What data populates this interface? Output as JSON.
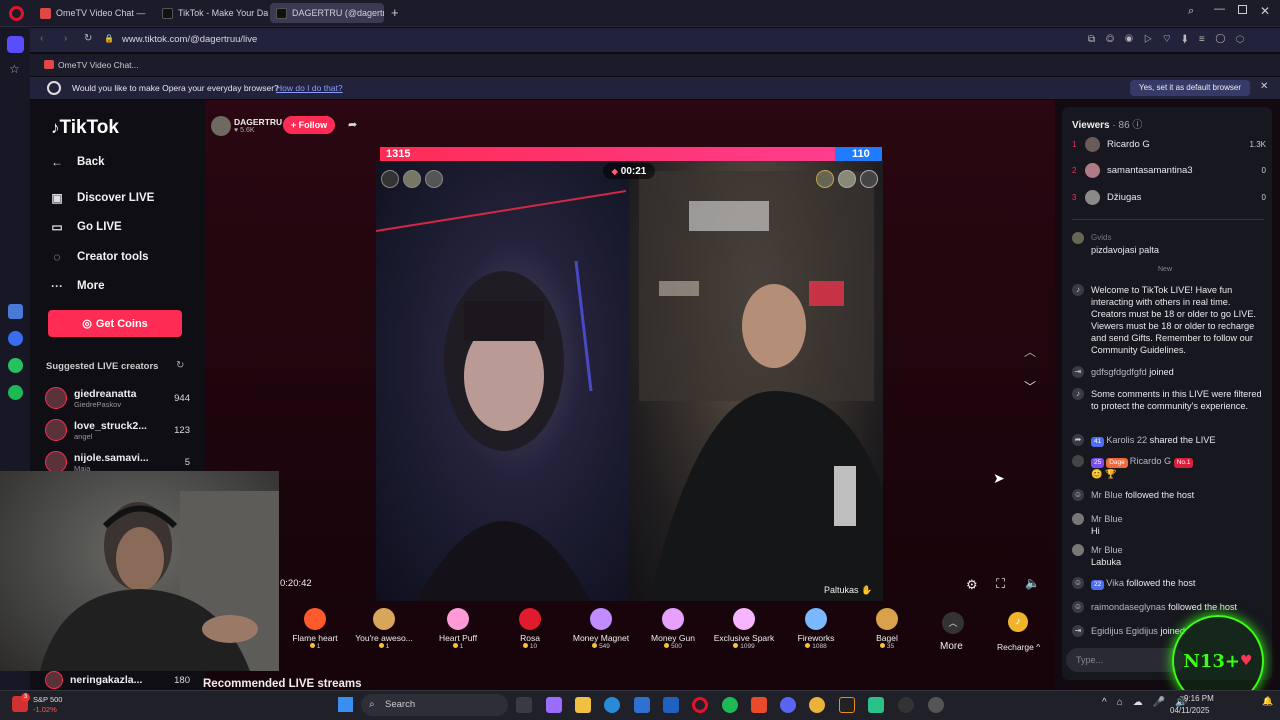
{
  "browser": {
    "tabs": [
      {
        "label": "OmeTV Video Chat — Or…",
        "active": false
      },
      {
        "label": "TikTok - Make Your Day",
        "active": false
      },
      {
        "label": "DAGERTRU (@dagertr…",
        "active": true
      }
    ],
    "url": "www.tiktok.com/@dagertruu/live",
    "bookmark": "OmeTV Video Chat...",
    "infobar": {
      "message": "Would you like to make Opera your everyday browser?",
      "link": "How do I do that?",
      "button": "Yes, set it as default browser"
    }
  },
  "tiktok": {
    "logo": "TikTok",
    "nav": {
      "back": "Back",
      "discover": "Discover LIVE",
      "golive": "Go LIVE",
      "creator_tools": "Creator tools",
      "more": "More",
      "get_coins": "Get Coins"
    },
    "suggested_title": "Suggested LIVE creators",
    "suggested": [
      {
        "name": "giedreanatta",
        "sub": "GiedrePaskov",
        "count": "944"
      },
      {
        "name": "love_struck2...",
        "sub": "angel",
        "count": "123"
      },
      {
        "name": "nijole.samavi...",
        "sub": "Maia",
        "count": "5"
      },
      {
        "name": "neringakazla...",
        "sub": "",
        "count": "180"
      }
    ],
    "recommended_title": "Recommended LIVE streams"
  },
  "stream": {
    "host_name": "DAGERTRU",
    "host_likes": "5.6K",
    "follow_label": "+ Follow",
    "score_left": "1315",
    "score_right": "110",
    "timer": "00:21",
    "live_time": "0:20:42",
    "guest_label": "Paltukas",
    "colors": {
      "accent": "#fe2c55",
      "blue": "#1f7bff"
    }
  },
  "gifts": [
    {
      "name": "Flame heart",
      "price": "1",
      "color": "#ff5a2c"
    },
    {
      "name": "You're aweso...",
      "price": "1",
      "color": "#d8a65a"
    },
    {
      "name": "Heart Puff",
      "price": "1",
      "color": "#ff9ad6"
    },
    {
      "name": "Rosa",
      "price": "10",
      "color": "#e01b2e"
    },
    {
      "name": "Money Magnet",
      "price": "549",
      "color": "#c08cff"
    },
    {
      "name": "Money Gun",
      "price": "500",
      "color": "#e8a0ff"
    },
    {
      "name": "Exclusive Spark",
      "price": "1099",
      "color": "#f6b6ff"
    },
    {
      "name": "Fireworks",
      "price": "1088",
      "color": "#7ab8ff"
    },
    {
      "name": "Bagel",
      "price": "35",
      "color": "#d9a24a"
    }
  ],
  "gift_more": "More",
  "recharge": "Recharge",
  "viewers": {
    "title": "Viewers",
    "count": "· 86",
    "list": [
      {
        "rank": "1",
        "name": "Ricardo G",
        "value": "1.3K"
      },
      {
        "rank": "2",
        "name": "samantasamantina3",
        "value": "0"
      },
      {
        "rank": "3",
        "name": "Džiugas",
        "value": "0"
      }
    ]
  },
  "chat": {
    "old_user": "Gvids",
    "old_text": "pizdavojasi palta",
    "new_divider": "New",
    "welcome": "Welcome to TikTok LIVE! Have fun interacting with others in real time. Creators must be 18 or older to go LIVE. Viewers must be 18 or older to recharge and send Gifts. Remember to follow our Community Guidelines.",
    "joined1_user": "gdfsgfdgdfgfd",
    "joined1_text": "joined",
    "filtered": "Some comments in this LIVE were filtered to protect the community's experience.",
    "share_badge": "41",
    "share_user": "Karolis 22",
    "share_text": "shared the LIVE",
    "ricardo_badge1": "25",
    "ricardo_badge2": "Dage",
    "ricardo_user": "Ricardo G",
    "ricardo_badge3": "No.1",
    "mrblue_follow_user": "Mr Blue",
    "mrblue_follow_text": "followed the host",
    "mrblue1_user": "Mr Blue",
    "mrblue1_text": "Hi",
    "mrblue2_user": "Mr Blue",
    "mrblue2_text": "Labuka",
    "vika_badge": "22",
    "vika_user": "Vika",
    "vika_text": "followed the host",
    "raimond_user": "raimondaseglynas",
    "raimond_text": "followed the host",
    "egid_user": "Egidijus Egidijus",
    "egid_text": "joined",
    "input_placeholder": "Type..."
  },
  "overlay_text": "N13+",
  "webcam_name": "",
  "taskbar": {
    "sp500": "S&P 500",
    "sp500_change": "-1.02%",
    "sp_badge": "3",
    "search": "Search",
    "time": "9:16 PM",
    "date": "04/11/2025"
  }
}
